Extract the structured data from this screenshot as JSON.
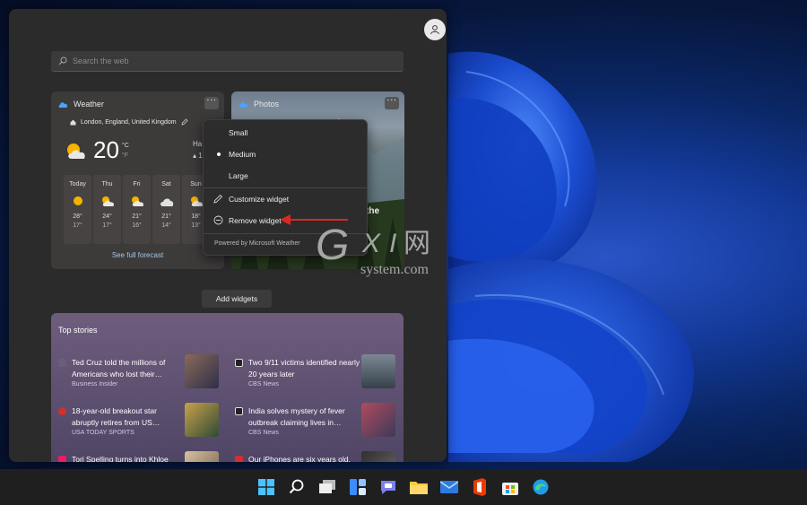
{
  "search": {
    "placeholder": "Search the web"
  },
  "weather": {
    "title": "Weather",
    "location": "London, England, United Kingdom",
    "temp": "20",
    "unit_c": "°C",
    "unit_f": "°F",
    "extra_line1": "Ha",
    "extra_line2": "10",
    "days": [
      {
        "name": "Today",
        "hi": "28°",
        "lo": "17°",
        "icon": "sun-icon"
      },
      {
        "name": "Thu",
        "hi": "24°",
        "lo": "17°",
        "icon": "partly-cloudy-icon"
      },
      {
        "name": "Fri",
        "hi": "21°",
        "lo": "16°",
        "icon": "partly-cloudy-icon"
      },
      {
        "name": "Sat",
        "hi": "21°",
        "lo": "14°",
        "icon": "cloud-icon"
      },
      {
        "name": "Sun",
        "hi": "18°",
        "lo": "13°",
        "icon": "partly-cloudy-icon"
      }
    ],
    "forecast_link": "See full forecast"
  },
  "photos": {
    "title": "Photos",
    "overlay_text": "the"
  },
  "menu": {
    "items": [
      "Small",
      "Medium",
      "Large"
    ],
    "selected": "Medium",
    "customize": "Customize widget",
    "remove": "Remove widget",
    "powered": "Powered by Microsoft Weather"
  },
  "add_widgets": "Add widgets",
  "watermark": {
    "brand": "GXI网",
    "domain": "system.com"
  },
  "stories": {
    "title": "Top stories",
    "items": [
      {
        "headline": "Ted Cruz told the millions of Americans who lost their…",
        "source": "Business Insider",
        "icon_color": "#6b5d7a"
      },
      {
        "headline": "Two 9/11 victims identified nearly 20 years later",
        "source": "CBS News",
        "icon_color": "#222222"
      },
      {
        "headline": "18-year-old breakout star abruptly retires from US…",
        "source": "USA TODAY SPORTS",
        "icon_color": "#d32f2f"
      },
      {
        "headline": "India solves mystery of fever outbreak claiming lives in…",
        "source": "CBS News",
        "icon_color": "#222222"
      },
      {
        "headline": "Tori Spelling turns into Khloe Kardashian after now…",
        "source": "",
        "icon_color": "#e91e63"
      },
      {
        "headline": "Our iPhones are six years old. Here's why we are…",
        "source": "",
        "icon_color": "#d32f2f"
      }
    ]
  },
  "taskbar": {
    "icons": [
      "start-icon",
      "search-icon",
      "task-view-icon",
      "widgets-icon",
      "chat-icon",
      "file-explorer-icon",
      "mail-icon",
      "office-icon",
      "store-icon",
      "edge-icon"
    ]
  },
  "colors": {
    "panel": "#2b2b2b",
    "accent_link": "#9ec9ee",
    "arrow": "#d9281f"
  }
}
